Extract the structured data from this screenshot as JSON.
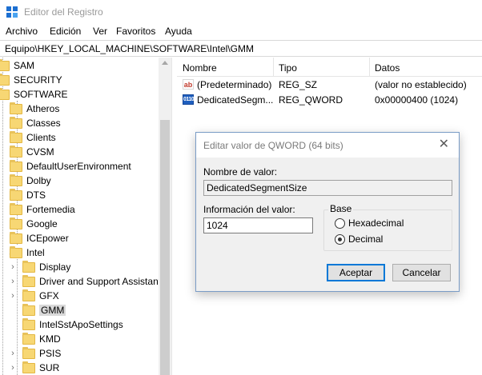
{
  "window": {
    "title": "Editor del Registro"
  },
  "menu": [
    "Archivo",
    "Edición",
    "Ver",
    "Favoritos",
    "Ayuda"
  ],
  "address": "Equipo\\HKEY_LOCAL_MACHINE\\SOFTWARE\\Intel\\GMM",
  "tree": {
    "root_items": [
      "SAM",
      "SECURITY",
      "SOFTWARE"
    ],
    "software_children": [
      "Atheros",
      "Classes",
      "Clients",
      "CVSM",
      "DefaultUserEnvironment",
      "Dolby",
      "DTS",
      "Fortemedia",
      "Google",
      "ICEpower",
      "Intel"
    ],
    "intel_children": [
      "Display",
      "Driver and Support Assistant",
      "GFX",
      "GMM",
      "IntelSstApoSettings",
      "KMD",
      "PSIS",
      "SUR"
    ],
    "selected": "GMM"
  },
  "list": {
    "columns": [
      "Nombre",
      "Tipo",
      "Datos"
    ],
    "rows": [
      {
        "icon": "string-value-icon",
        "name": "(Predeterminado)",
        "type": "REG_SZ",
        "data": "(valor no establecido)"
      },
      {
        "icon": "binary-value-icon",
        "name": "DedicatedSegm...",
        "type": "REG_QWORD",
        "data": "0x00000400 (1024)"
      }
    ]
  },
  "dialog": {
    "title": "Editar valor de QWORD (64 bits)",
    "value_name_label": "Nombre de valor:",
    "value_name": "DedicatedSegmentSize",
    "value_data_label": "Información del valor:",
    "value_data": "1024",
    "base_label": "Base",
    "base_options": [
      "Hexadecimal",
      "Decimal"
    ],
    "base_selected": "Decimal",
    "ok_label": "Aceptar",
    "cancel_label": "Cancelar"
  }
}
